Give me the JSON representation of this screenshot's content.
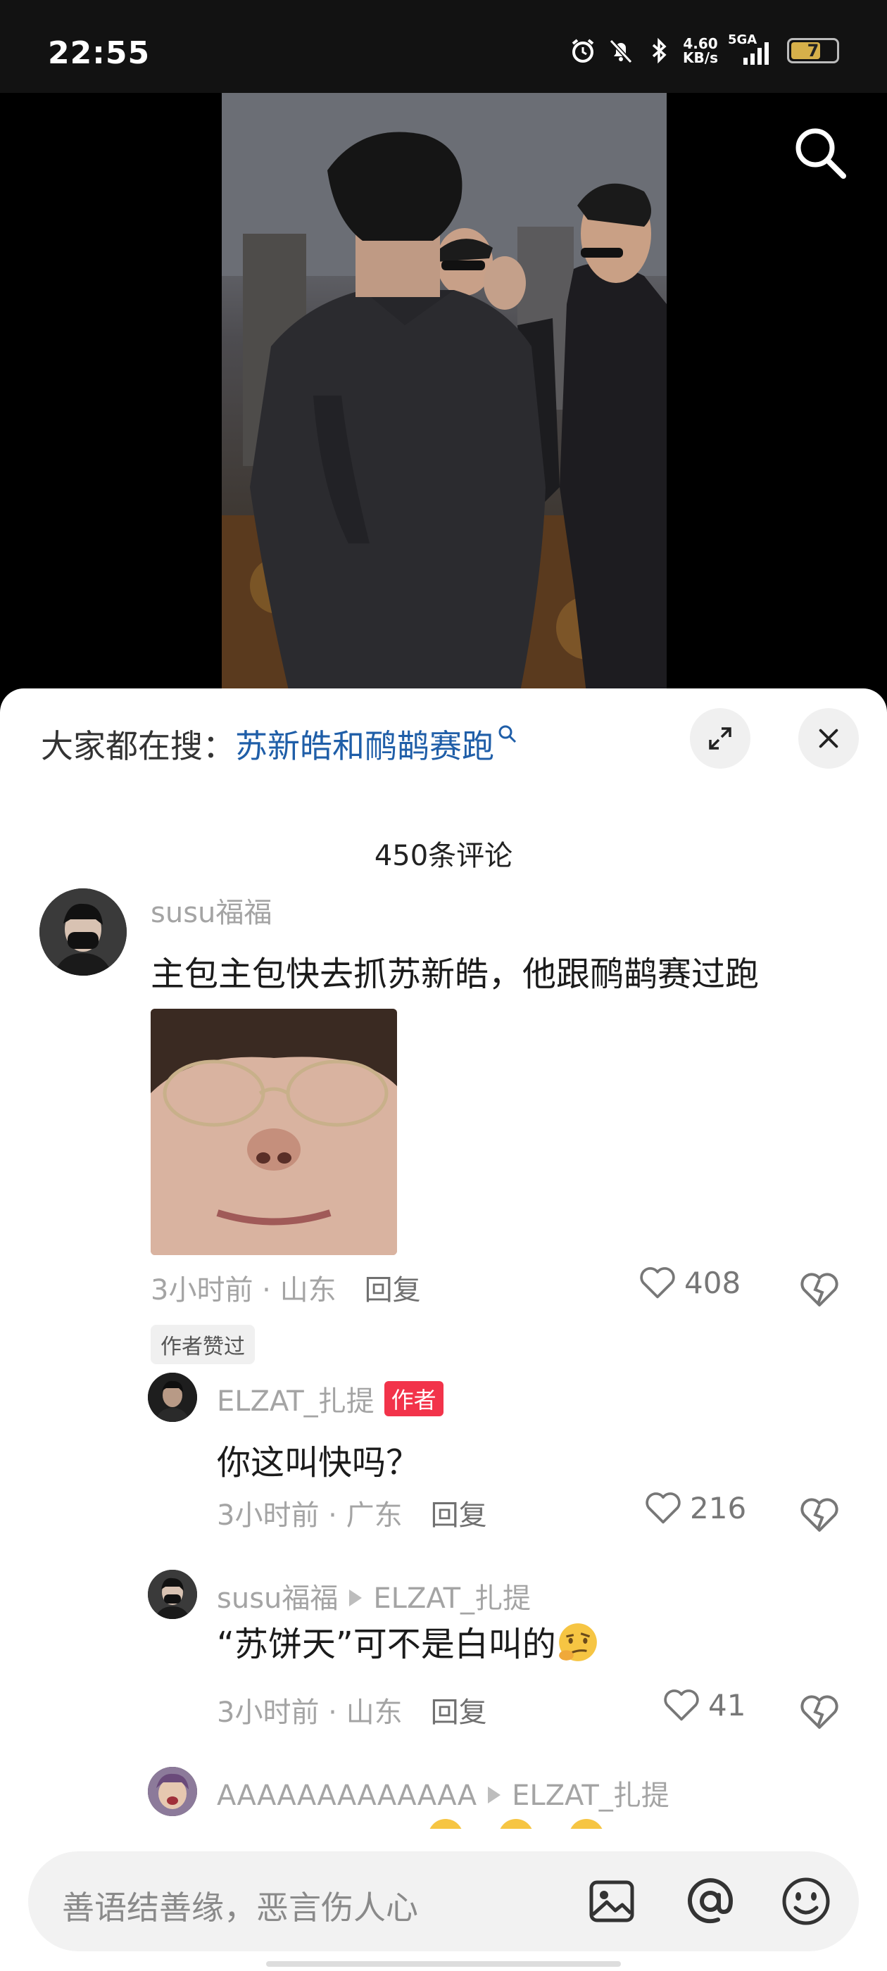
{
  "status_bar": {
    "time": "22:55",
    "net_speed_value": "4.60",
    "net_speed_unit": "KB/s",
    "signal_label": "5GA",
    "battery": "7"
  },
  "hot_search": {
    "prefix": "大家都在搜：",
    "term": "苏新皓和鸸鹋赛跑"
  },
  "comment_count": "450条评论",
  "comments": [
    {
      "user": "susu福福",
      "text": "主包主包快去抓苏新皓，他跟鸸鹋赛过跑",
      "time_loc": "3小时前 · 山东",
      "reply_label": "回复",
      "likes": "408",
      "badge": "作者赞过"
    },
    {
      "user": "ELZAT_扎提",
      "author_badge": "作者",
      "text": "你这叫快吗？",
      "time_loc": "3小时前 · 广东",
      "reply_label": "回复",
      "likes": "216"
    },
    {
      "user": "susu福福",
      "reply_to": "ELZAT_扎提",
      "text": "“苏饼天”可不是白叫的",
      "time_loc": "3小时前 · 山东",
      "reply_label": "回复",
      "likes": "41"
    },
    {
      "user": "AAAAAAAAAAAAA",
      "reply_to": "ELZAT_扎提"
    }
  ],
  "input": {
    "placeholder": "善语结善缘，恶言伤人心"
  },
  "colors": {
    "link": "#1f5ea8",
    "author_badge": "#f2334a",
    "sheet_bg": "#ffffff",
    "meta_gray": "#a4a4a4"
  }
}
